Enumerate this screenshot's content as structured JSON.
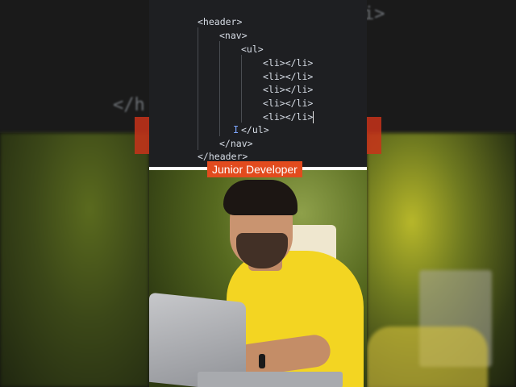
{
  "code_editor": {
    "lines": [
      "<header>",
      "<nav>",
      "<ul>",
      "<li></li>",
      "<li></li>",
      "<li></li>",
      "<li></li>",
      "<li></li>",
      "</ul>",
      "</nav>",
      "</header>"
    ]
  },
  "caption": {
    "text": "Junior Developer",
    "background_color": "#e24b1e"
  },
  "background_ghost": {
    "left_text": "</h",
    "right_text": "i>"
  }
}
